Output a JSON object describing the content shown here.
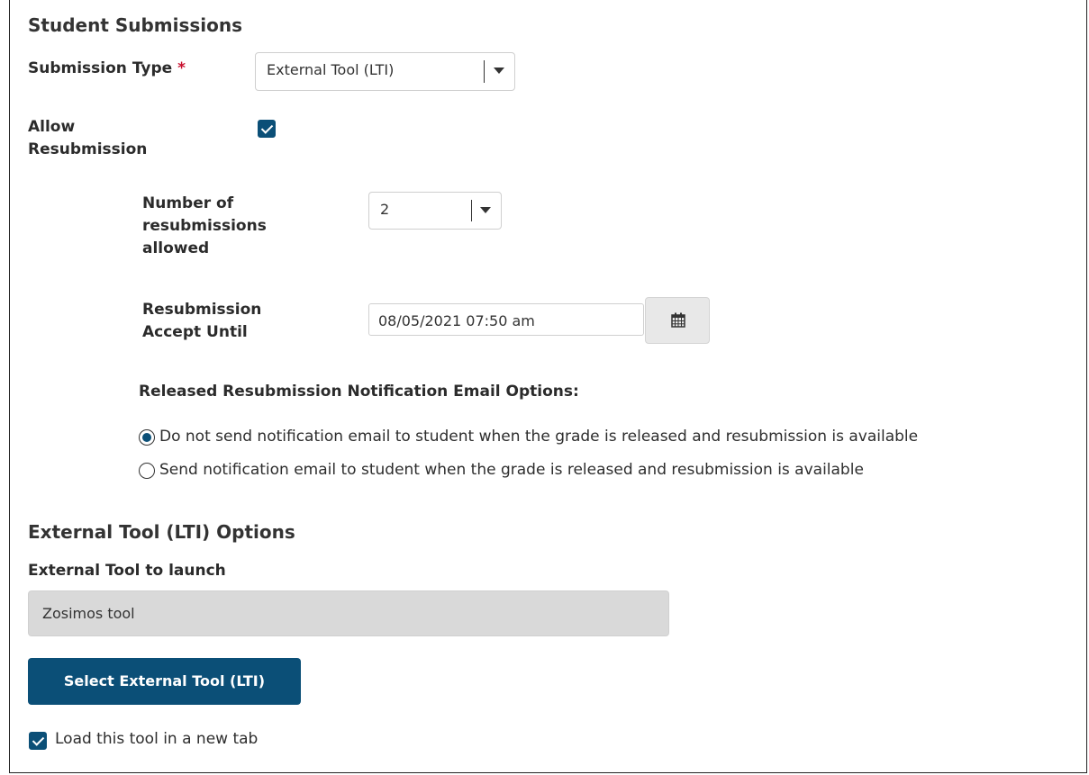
{
  "section_title": "Student Submissions",
  "submission_type": {
    "label": "Submission Type",
    "required_mark": "*",
    "selected_value": "External Tool (LTI)"
  },
  "allow_resubmission": {
    "label_line1": "Allow",
    "label_line2": "Resubmission",
    "checked": true
  },
  "resubmissions_allowed": {
    "label_line1": "Number of",
    "label_line2": "resubmissions",
    "label_line3": "allowed",
    "selected_value": "2"
  },
  "accept_until": {
    "label_line1": "Resubmission",
    "label_line2": "Accept Until",
    "value": "08/05/2021 07:50 am",
    "icon": "calendar-icon"
  },
  "notification": {
    "heading": "Released Resubmission Notification Email Options:",
    "options": [
      {
        "label": "Do not send notification email to student when the grade is released and resubmission is available",
        "selected": true
      },
      {
        "label": "Send notification email to student when the grade is released and resubmission is available",
        "selected": false
      }
    ]
  },
  "lti_options": {
    "heading": "External Tool (LTI) Options",
    "tool_label": "External Tool to launch",
    "tool_value": "Zosimos tool",
    "select_button": "Select External Tool (LTI)",
    "new_tab_label": "Load this tool in a new tab",
    "new_tab_checked": true
  },
  "colors": {
    "accent": "#0b4f77",
    "required": "#c8102e",
    "readonly_bg": "#d9d9d9"
  }
}
